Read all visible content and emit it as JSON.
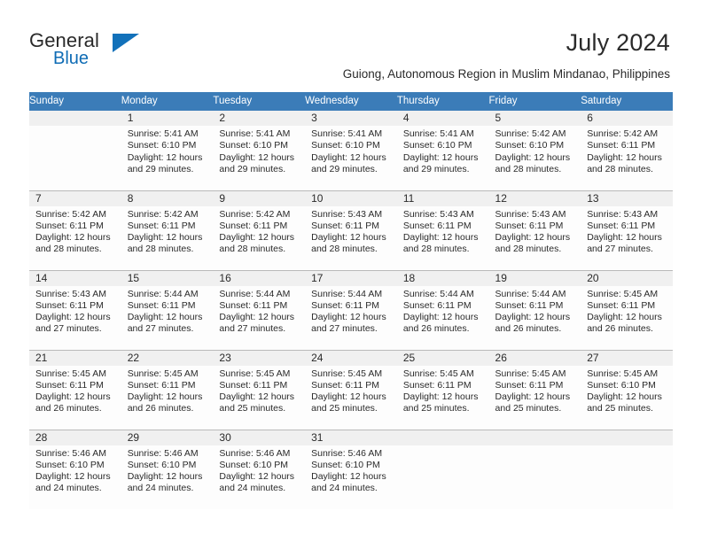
{
  "brand": {
    "name_part1": "General",
    "name_part2": "Blue",
    "flag_icon": "triangle-flag-icon"
  },
  "header": {
    "title": "July 2024",
    "subtitle": "Guiong, Autonomous Region in Muslim Mindanao, Philippines"
  },
  "calendar": {
    "weekday_headers": [
      "Sunday",
      "Monday",
      "Tuesday",
      "Wednesday",
      "Thursday",
      "Friday",
      "Saturday"
    ],
    "colors": {
      "header_background": "#3b7cb8",
      "header_text": "#ffffff",
      "daynum_background": "#f0f0f0",
      "cell_background": "#fdfdfd",
      "grid_line": "#b9b9b9",
      "brand_blue": "#1271ba",
      "text": "#2a2a2a"
    },
    "weeks": [
      [
        {
          "day": "",
          "lines": []
        },
        {
          "day": "1",
          "lines": [
            "Sunrise: 5:41 AM",
            "Sunset: 6:10 PM",
            "Daylight: 12 hours",
            "and 29 minutes."
          ]
        },
        {
          "day": "2",
          "lines": [
            "Sunrise: 5:41 AM",
            "Sunset: 6:10 PM",
            "Daylight: 12 hours",
            "and 29 minutes."
          ]
        },
        {
          "day": "3",
          "lines": [
            "Sunrise: 5:41 AM",
            "Sunset: 6:10 PM",
            "Daylight: 12 hours",
            "and 29 minutes."
          ]
        },
        {
          "day": "4",
          "lines": [
            "Sunrise: 5:41 AM",
            "Sunset: 6:10 PM",
            "Daylight: 12 hours",
            "and 29 minutes."
          ]
        },
        {
          "day": "5",
          "lines": [
            "Sunrise: 5:42 AM",
            "Sunset: 6:10 PM",
            "Daylight: 12 hours",
            "and 28 minutes."
          ]
        },
        {
          "day": "6",
          "lines": [
            "Sunrise: 5:42 AM",
            "Sunset: 6:11 PM",
            "Daylight: 12 hours",
            "and 28 minutes."
          ]
        }
      ],
      [
        {
          "day": "7",
          "lines": [
            "Sunrise: 5:42 AM",
            "Sunset: 6:11 PM",
            "Daylight: 12 hours",
            "and 28 minutes."
          ]
        },
        {
          "day": "8",
          "lines": [
            "Sunrise: 5:42 AM",
            "Sunset: 6:11 PM",
            "Daylight: 12 hours",
            "and 28 minutes."
          ]
        },
        {
          "day": "9",
          "lines": [
            "Sunrise: 5:42 AM",
            "Sunset: 6:11 PM",
            "Daylight: 12 hours",
            "and 28 minutes."
          ]
        },
        {
          "day": "10",
          "lines": [
            "Sunrise: 5:43 AM",
            "Sunset: 6:11 PM",
            "Daylight: 12 hours",
            "and 28 minutes."
          ]
        },
        {
          "day": "11",
          "lines": [
            "Sunrise: 5:43 AM",
            "Sunset: 6:11 PM",
            "Daylight: 12 hours",
            "and 28 minutes."
          ]
        },
        {
          "day": "12",
          "lines": [
            "Sunrise: 5:43 AM",
            "Sunset: 6:11 PM",
            "Daylight: 12 hours",
            "and 28 minutes."
          ]
        },
        {
          "day": "13",
          "lines": [
            "Sunrise: 5:43 AM",
            "Sunset: 6:11 PM",
            "Daylight: 12 hours",
            "and 27 minutes."
          ]
        }
      ],
      [
        {
          "day": "14",
          "lines": [
            "Sunrise: 5:43 AM",
            "Sunset: 6:11 PM",
            "Daylight: 12 hours",
            "and 27 minutes."
          ]
        },
        {
          "day": "15",
          "lines": [
            "Sunrise: 5:44 AM",
            "Sunset: 6:11 PM",
            "Daylight: 12 hours",
            "and 27 minutes."
          ]
        },
        {
          "day": "16",
          "lines": [
            "Sunrise: 5:44 AM",
            "Sunset: 6:11 PM",
            "Daylight: 12 hours",
            "and 27 minutes."
          ]
        },
        {
          "day": "17",
          "lines": [
            "Sunrise: 5:44 AM",
            "Sunset: 6:11 PM",
            "Daylight: 12 hours",
            "and 27 minutes."
          ]
        },
        {
          "day": "18",
          "lines": [
            "Sunrise: 5:44 AM",
            "Sunset: 6:11 PM",
            "Daylight: 12 hours",
            "and 26 minutes."
          ]
        },
        {
          "day": "19",
          "lines": [
            "Sunrise: 5:44 AM",
            "Sunset: 6:11 PM",
            "Daylight: 12 hours",
            "and 26 minutes."
          ]
        },
        {
          "day": "20",
          "lines": [
            "Sunrise: 5:45 AM",
            "Sunset: 6:11 PM",
            "Daylight: 12 hours",
            "and 26 minutes."
          ]
        }
      ],
      [
        {
          "day": "21",
          "lines": [
            "Sunrise: 5:45 AM",
            "Sunset: 6:11 PM",
            "Daylight: 12 hours",
            "and 26 minutes."
          ]
        },
        {
          "day": "22",
          "lines": [
            "Sunrise: 5:45 AM",
            "Sunset: 6:11 PM",
            "Daylight: 12 hours",
            "and 26 minutes."
          ]
        },
        {
          "day": "23",
          "lines": [
            "Sunrise: 5:45 AM",
            "Sunset: 6:11 PM",
            "Daylight: 12 hours",
            "and 25 minutes."
          ]
        },
        {
          "day": "24",
          "lines": [
            "Sunrise: 5:45 AM",
            "Sunset: 6:11 PM",
            "Daylight: 12 hours",
            "and 25 minutes."
          ]
        },
        {
          "day": "25",
          "lines": [
            "Sunrise: 5:45 AM",
            "Sunset: 6:11 PM",
            "Daylight: 12 hours",
            "and 25 minutes."
          ]
        },
        {
          "day": "26",
          "lines": [
            "Sunrise: 5:45 AM",
            "Sunset: 6:11 PM",
            "Daylight: 12 hours",
            "and 25 minutes."
          ]
        },
        {
          "day": "27",
          "lines": [
            "Sunrise: 5:45 AM",
            "Sunset: 6:10 PM",
            "Daylight: 12 hours",
            "and 25 minutes."
          ]
        }
      ],
      [
        {
          "day": "28",
          "lines": [
            "Sunrise: 5:46 AM",
            "Sunset: 6:10 PM",
            "Daylight: 12 hours",
            "and 24 minutes."
          ]
        },
        {
          "day": "29",
          "lines": [
            "Sunrise: 5:46 AM",
            "Sunset: 6:10 PM",
            "Daylight: 12 hours",
            "and 24 minutes."
          ]
        },
        {
          "day": "30",
          "lines": [
            "Sunrise: 5:46 AM",
            "Sunset: 6:10 PM",
            "Daylight: 12 hours",
            "and 24 minutes."
          ]
        },
        {
          "day": "31",
          "lines": [
            "Sunrise: 5:46 AM",
            "Sunset: 6:10 PM",
            "Daylight: 12 hours",
            "and 24 minutes."
          ]
        },
        {
          "day": "",
          "lines": []
        },
        {
          "day": "",
          "lines": []
        },
        {
          "day": "",
          "lines": []
        }
      ]
    ]
  }
}
